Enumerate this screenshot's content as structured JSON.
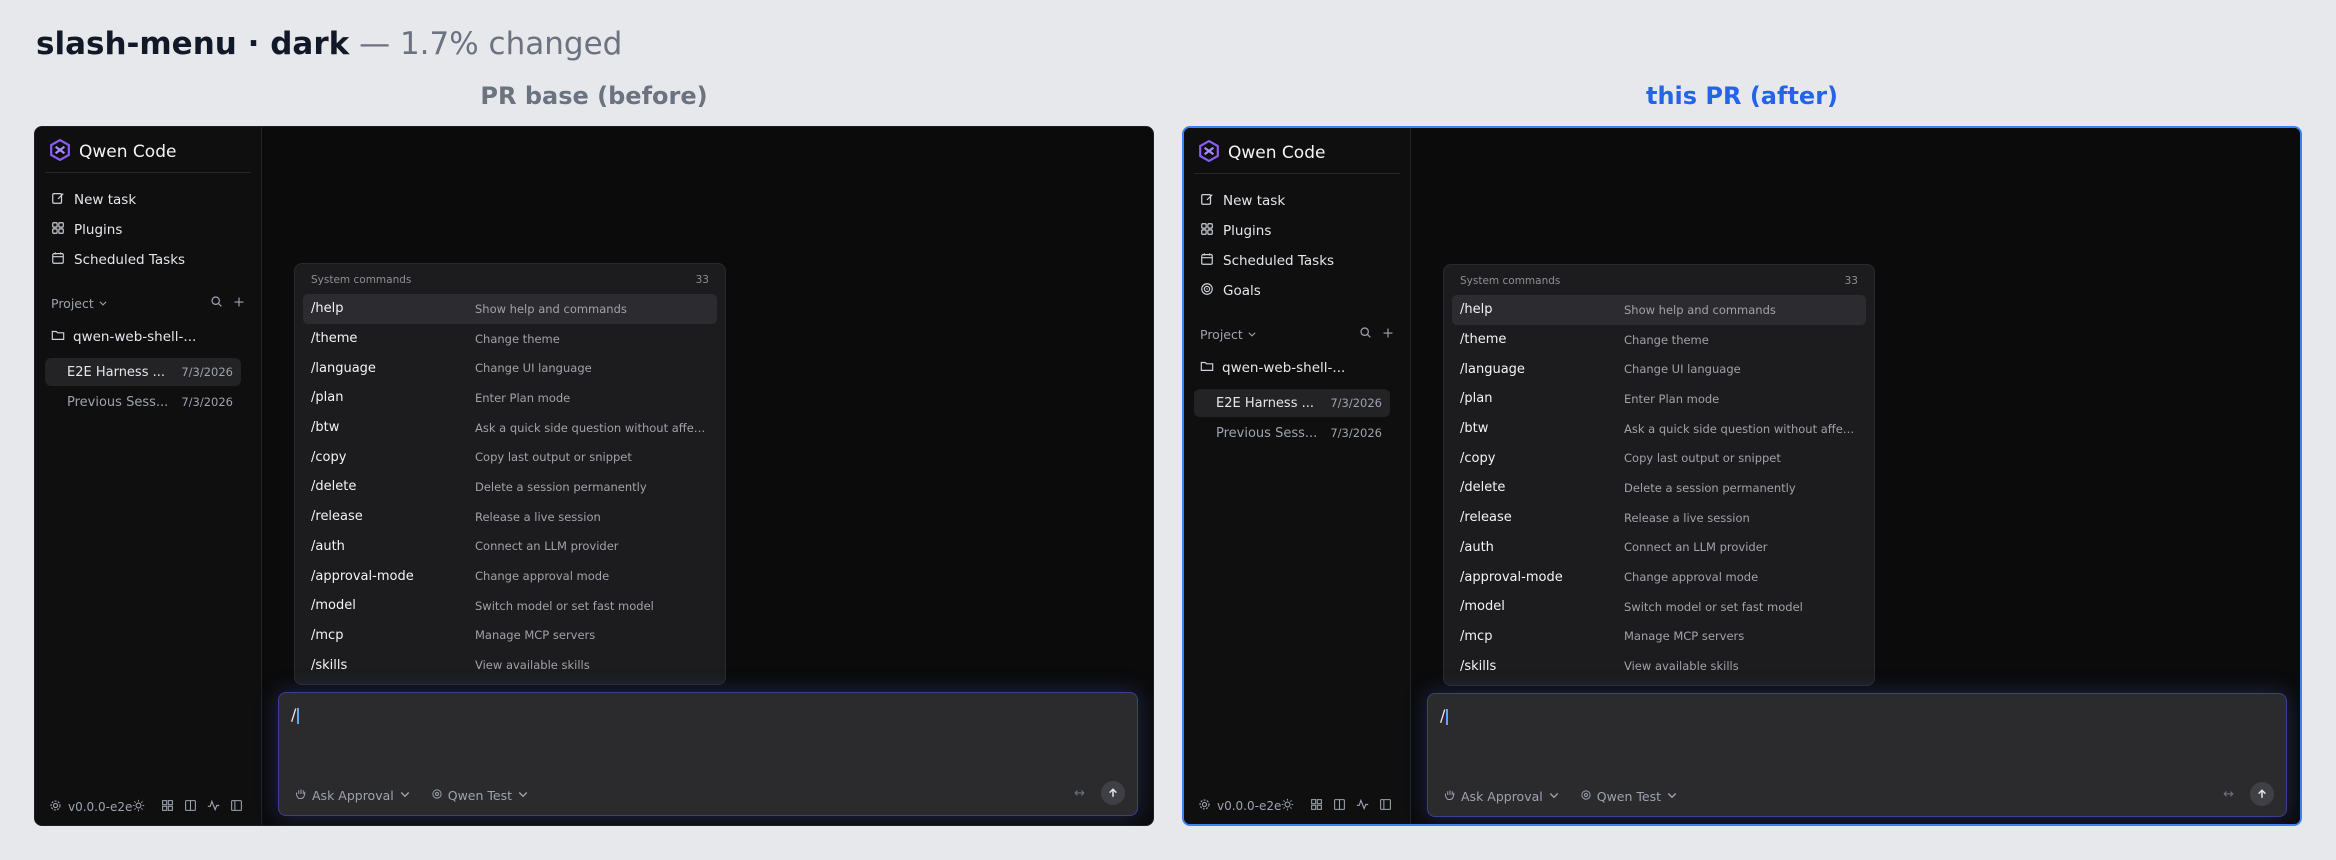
{
  "header": {
    "title_bold": "slash-menu · dark",
    "title_rest": " — 1.7% changed"
  },
  "panels": [
    {
      "label": "PR base (before)",
      "app_name": "Qwen Code",
      "nav": [
        {
          "label": "New task",
          "icon": "edit-icon"
        },
        {
          "label": "Plugins",
          "icon": "plugin-icon"
        },
        {
          "label": "Scheduled Tasks",
          "icon": "calendar-icon"
        }
      ],
      "project_label": "Project",
      "folder": "qwen-web-shell-...",
      "sessions": [
        {
          "title": "E2E Harness ...",
          "date": "7/3/2026"
        },
        {
          "title": "Previous Sess...",
          "date": "7/3/2026"
        }
      ],
      "version": "v0.0.0-e2e"
    },
    {
      "label": "this PR (after)",
      "app_name": "Qwen Code",
      "nav": [
        {
          "label": "New task",
          "icon": "edit-icon"
        },
        {
          "label": "Plugins",
          "icon": "plugin-icon"
        },
        {
          "label": "Scheduled Tasks",
          "icon": "calendar-icon"
        },
        {
          "label": "Goals",
          "icon": "target-icon"
        }
      ],
      "project_label": "Project",
      "folder": "qwen-web-shell-...",
      "sessions": [
        {
          "title": "E2E Harness ...",
          "date": "7/3/2026"
        },
        {
          "title": "Previous Sess...",
          "date": "7/3/2026"
        }
      ],
      "version": "v0.0.0-e2e"
    }
  ],
  "menu": {
    "heading": "System commands",
    "count": "33",
    "items": [
      {
        "cmd": "/help",
        "desc": "Show help and commands"
      },
      {
        "cmd": "/theme",
        "desc": "Change theme"
      },
      {
        "cmd": "/language",
        "desc": "Change UI language"
      },
      {
        "cmd": "/plan",
        "desc": "Enter Plan mode"
      },
      {
        "cmd": "/btw",
        "desc": "Ask a quick side question without affecting..."
      },
      {
        "cmd": "/copy",
        "desc": "Copy last output or snippet"
      },
      {
        "cmd": "/delete",
        "desc": "Delete a session permanently"
      },
      {
        "cmd": "/release",
        "desc": "Release a live session"
      },
      {
        "cmd": "/auth",
        "desc": "Connect an LLM provider"
      },
      {
        "cmd": "/approval-mode",
        "desc": "Change approval mode"
      },
      {
        "cmd": "/model",
        "desc": "Switch model or set fast model"
      },
      {
        "cmd": "/mcp",
        "desc": "Manage MCP servers"
      },
      {
        "cmd": "/skills",
        "desc": "View available skills"
      }
    ]
  },
  "composer": {
    "text": "/",
    "approval_label": "Ask Approval",
    "model_label": "Qwen Test",
    "expand_glyph": "↔"
  },
  "colors": {
    "accent": "#2563eb",
    "selected_row": "#2c2c30",
    "background": "#0b0b0c"
  }
}
